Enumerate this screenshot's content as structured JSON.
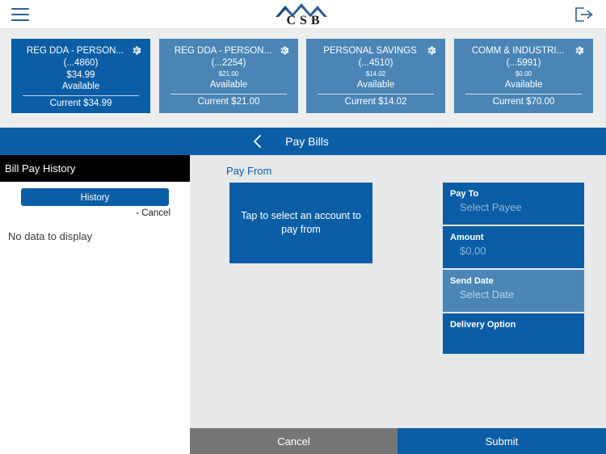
{
  "appbar": {
    "menu_icon": "hamburger-menu-icon",
    "logo_text": "CSB",
    "logo_icon": "csb-mountain-logo",
    "logout_icon": "logout-icon"
  },
  "accounts": [
    {
      "title": "REG DDA - PERSON...",
      "number": "(...4860)",
      "available_amount": "$34.99",
      "available_label": "Available",
      "current": "Current $34.99",
      "selected": true,
      "small_amount": false,
      "gear_icon": "gear-icon"
    },
    {
      "title": "REG DDA - PERSON...",
      "number": "(...2254)",
      "available_amount": "$21.00",
      "available_label": "Available",
      "current": "Current $21.00",
      "selected": false,
      "small_amount": true,
      "gear_icon": "gear-icon"
    },
    {
      "title": "PERSONAL SAVINGS",
      "number": "(...4510)",
      "available_amount": "$14.02",
      "available_label": "Available",
      "current": "Current $14.02",
      "selected": false,
      "small_amount": true,
      "gear_icon": "gear-icon"
    },
    {
      "title": "COMM & INDUSTRI...",
      "number": "(...5991)",
      "available_amount": "$0.00",
      "available_label": "Available",
      "current": "Current $70.00",
      "selected": false,
      "small_amount": true,
      "gear_icon": "gear-icon"
    }
  ],
  "navbar": {
    "back_icon": "chevron-left-icon",
    "title": "Pay Bills"
  },
  "left_panel": {
    "header": "Bill Pay History",
    "history_button": "History",
    "cancel_link": "- Cancel",
    "empty_message": "No data to display"
  },
  "main": {
    "pay_from_label": "Pay From",
    "pay_from_placeholder": "Tap to select an account to pay from",
    "fields": [
      {
        "label": "Pay To",
        "value": "Select Payee",
        "highlight": false
      },
      {
        "label": "Amount",
        "value": "$0.00",
        "highlight": false
      },
      {
        "label": "Send Date",
        "value": "Select Date",
        "highlight": true
      },
      {
        "label": "Delivery Option",
        "value": "",
        "highlight": false
      }
    ]
  },
  "footer": {
    "cancel_label": "Cancel",
    "submit_label": "Submit"
  },
  "colors": {
    "brand_blue": "#0b5ea5",
    "light_blue": "#4a85b5",
    "gray_bg": "#e7e8e9",
    "cancel_gray": "#767676",
    "black_header": "#000000"
  }
}
